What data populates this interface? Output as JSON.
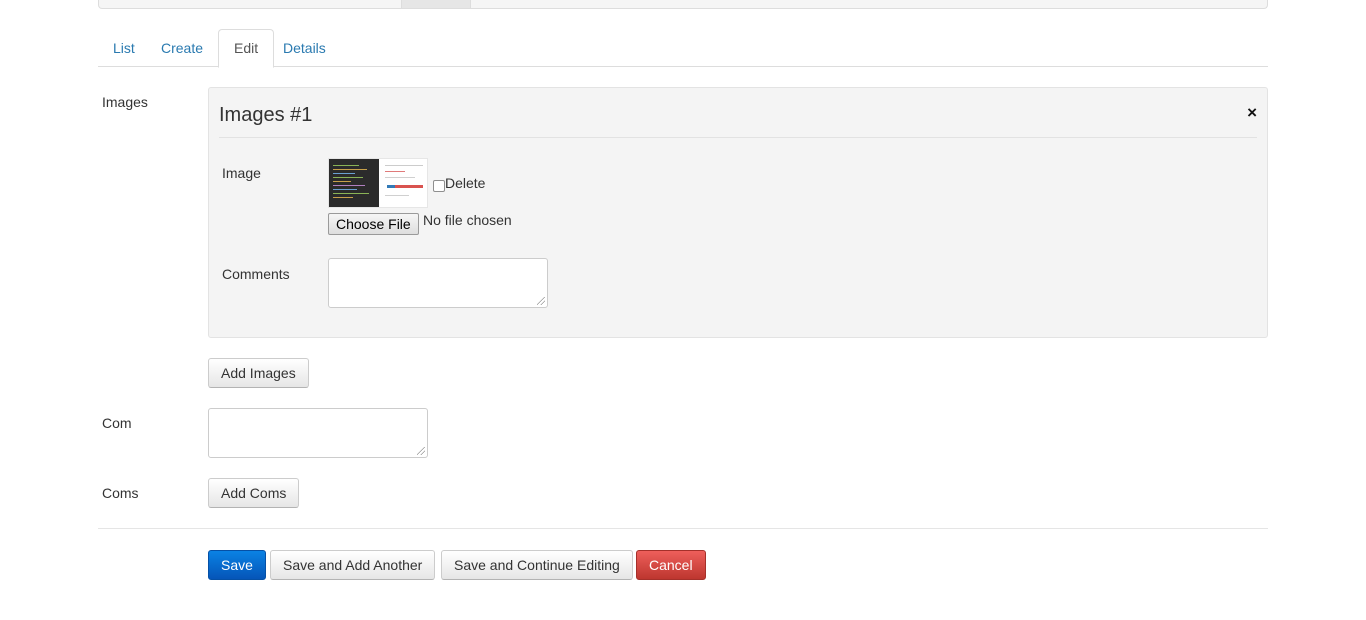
{
  "tabs": [
    {
      "label": "List"
    },
    {
      "label": "Create"
    },
    {
      "label": "Edit"
    },
    {
      "label": "Details"
    }
  ],
  "form": {
    "images_label": "Images",
    "images_panel": {
      "title": "Images #1",
      "close_icon": "×",
      "image_label": "Image",
      "delete_label": "Delete",
      "file_button_label": "Choose File",
      "file_status": "No file chosen",
      "comments_label": "Comments",
      "comments_value": ""
    },
    "add_images_label": "Add Images",
    "com_label": "Com",
    "com_value": "",
    "coms_label": "Coms",
    "add_coms_label": "Add Coms"
  },
  "actions": {
    "save": "Save",
    "save_add_another": "Save and Add Another",
    "save_continue": "Save and Continue Editing",
    "cancel": "Cancel"
  }
}
